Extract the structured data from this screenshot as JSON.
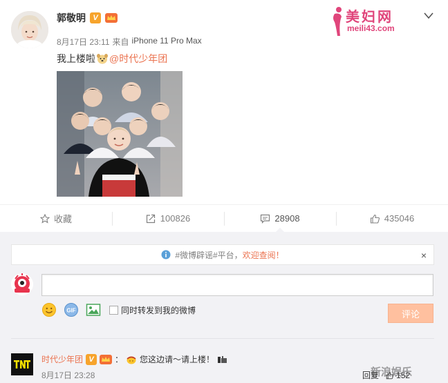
{
  "post": {
    "author": "郭敬明",
    "verified_badge": "V",
    "timestamp": "8月17日 23:11",
    "source_prefix": "来自",
    "source": "iPhone 11 Pro Max",
    "text": "我上楼啦",
    "mention": "@时代少年团"
  },
  "watermark": {
    "title": "美妇网",
    "url": "meili43.com"
  },
  "actions": [
    {
      "icon": "star-icon",
      "label": "收藏"
    },
    {
      "icon": "share-icon",
      "label": "100826"
    },
    {
      "icon": "comment-icon",
      "label": "28908"
    },
    {
      "icon": "like-icon",
      "label": "435046"
    }
  ],
  "notice": {
    "text": "#微博辟谣#平台，",
    "link": "欢迎查阅！",
    "close": "×"
  },
  "composer": {
    "input_value": "",
    "checkbox_label": "同时转发到我的微博",
    "submit_label": "评论"
  },
  "reply": {
    "author": "时代少年团",
    "verified_badge": "V",
    "separator": "：",
    "text": "您这边请～请上楼！",
    "timestamp": "8月17日 23:28",
    "action_label": "回复",
    "like_count": "152",
    "overlay_text": "新浪娱乐"
  },
  "colors": {
    "accent": "#eb7350",
    "badge": "#f7a42c",
    "panel": "#f2f2f5",
    "submit": "#ffc09f",
    "watermark": "#e0457b"
  }
}
